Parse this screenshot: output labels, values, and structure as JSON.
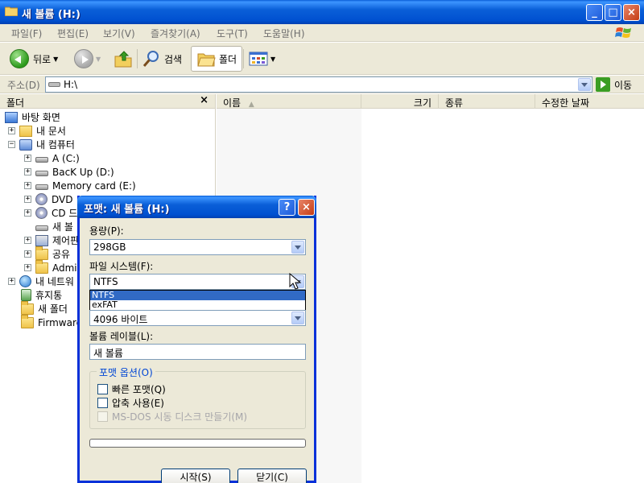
{
  "window": {
    "title": "새 볼륨 (H:)",
    "buttons": {
      "minimize": "_",
      "maximize": "□",
      "close": "×"
    }
  },
  "menu": [
    "파일(F)",
    "편집(E)",
    "보기(V)",
    "즐겨찾기(A)",
    "도구(T)",
    "도움말(H)"
  ],
  "toolbar": {
    "back_label": "뒤로",
    "search_label": "검색",
    "folders_label": "폴더"
  },
  "address": {
    "label": "주소(D)",
    "value": "H:\\",
    "go_label": "이동"
  },
  "tree": {
    "header": "폴더",
    "close_glyph": "×",
    "nodes": [
      {
        "label": "바탕 화면",
        "icon": "desktop-icon",
        "expander": ""
      },
      {
        "label": "내 문서",
        "icon": "my-documents-icon",
        "expander": "+"
      },
      {
        "label": "내 컴퓨터",
        "icon": "my-computer-icon",
        "expander": "−"
      },
      {
        "label": "A (C:)",
        "icon": "hard-drive-icon",
        "expander": "+"
      },
      {
        "label": "BacK Up (D:)",
        "icon": "hard-drive-icon",
        "expander": "+"
      },
      {
        "label": "Memory card (E:)",
        "icon": "hard-drive-icon",
        "expander": "+"
      },
      {
        "label": "DVD",
        "icon": "dvd-drive-icon",
        "expander": "+"
      },
      {
        "label": "CD 드",
        "icon": "cd-drive-icon",
        "expander": "+"
      },
      {
        "label": "새 볼",
        "icon": "hard-drive-icon",
        "expander": ""
      },
      {
        "label": "제어판",
        "icon": "control-panel-icon",
        "expander": "+"
      },
      {
        "label": "공유",
        "icon": "folder-icon",
        "expander": "+"
      },
      {
        "label": "Admi",
        "icon": "folder-icon",
        "expander": "+"
      },
      {
        "label": "내 네트워",
        "icon": "network-icon",
        "expander": "+"
      },
      {
        "label": "휴지통",
        "icon": "recycle-bin-icon",
        "expander": ""
      },
      {
        "label": "새 폴더",
        "icon": "folder-icon",
        "expander": ""
      },
      {
        "label": "Firmware",
        "icon": "folder-icon",
        "expander": ""
      }
    ]
  },
  "list": {
    "columns": [
      "이름",
      "크기",
      "종류",
      "수정한 날짜"
    ],
    "sort_glyph": "▲"
  },
  "dialog": {
    "title": "포맷: 새 볼륨 (H:)",
    "help_glyph": "?",
    "close_glyph": "×",
    "capacity_label": "용량(P):",
    "capacity_value": "298GB",
    "fs_label": "파일 시스템(F):",
    "fs_value": "NTFS",
    "fs_options": [
      "NTFS",
      "exFAT"
    ],
    "alloc_value": "4096 바이트",
    "volume_label_label": "볼륨 레이블(L):",
    "volume_label_value": "새 볼륨",
    "options_legend": "포맷 옵션(O)",
    "quick_format": "빠른 포맷(Q)",
    "compression": "압축 사용(E)",
    "msdos_disk": "MS-DOS 시동 디스크 만들기(M)",
    "start_button": "시작(S)",
    "close_button": "닫기(C)"
  }
}
